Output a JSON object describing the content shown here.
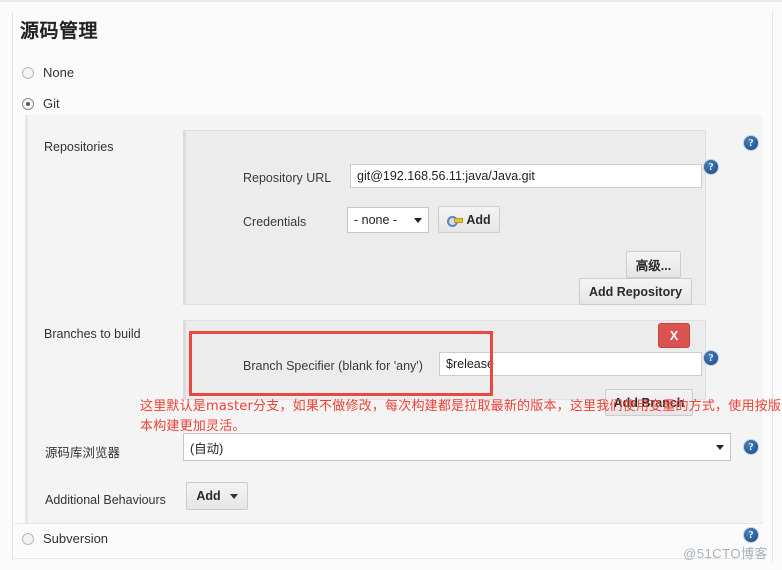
{
  "page": {
    "title": "源码管理",
    "watermark": "@51CTO博客"
  },
  "scm_options": [
    {
      "label": "None",
      "selected": false
    },
    {
      "label": "Git",
      "selected": true
    },
    {
      "label": "Subversion",
      "selected": false
    }
  ],
  "git": {
    "repositories": {
      "section_label": "Repositories",
      "repository_url": {
        "label": "Repository URL",
        "value": "git@192.168.56.11:java/Java.git",
        "placeholder": ""
      },
      "credentials": {
        "label": "Credentials",
        "value": "- none -",
        "add_button": "Add"
      },
      "advanced_button": "高级...",
      "add_repository_button": "Add Repository"
    },
    "branches": {
      "section_label": "Branches to build",
      "branch_specifier": {
        "label": "Branch Specifier (blank for 'any')",
        "value": "$release",
        "placeholder": ""
      },
      "delete_button": "X",
      "add_branch_button": "Add Branch"
    },
    "repository_browser": {
      "label": "源码库浏览器",
      "value": "(自动)"
    },
    "additional_behaviours": {
      "label": "Additional Behaviours",
      "add_button": "Add"
    }
  },
  "annotation": {
    "text": "这里默认是master分支，如果不做修改，每次构建都是拉取最新的版本，这里我们使用变量的方式，使用按版本构建更加灵活。",
    "color": "#ef4136"
  },
  "help_icon_glyph": "?"
}
